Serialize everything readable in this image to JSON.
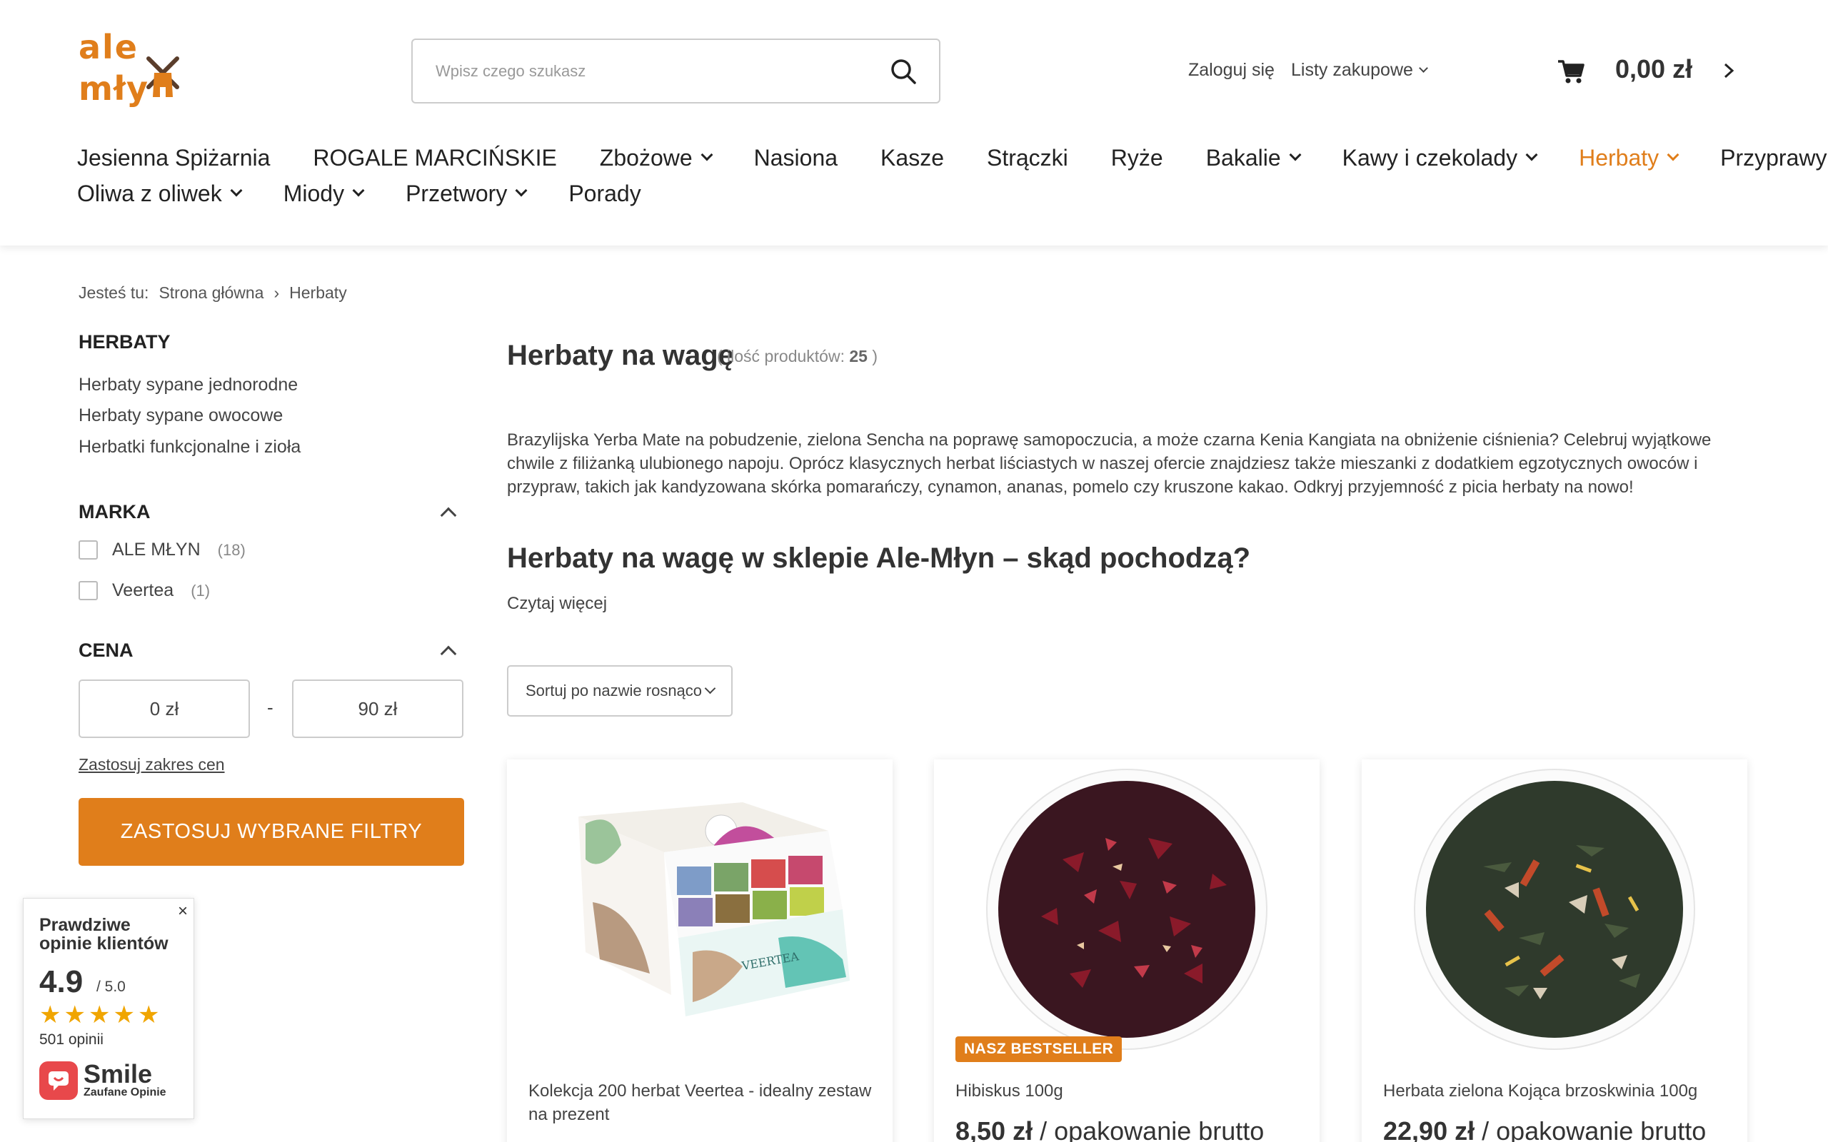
{
  "header": {
    "logo_line1": "ale",
    "logo_line2": "młyn",
    "search_placeholder": "Wpisz czego szukasz",
    "login": "Zaloguj się",
    "shopping_lists": "Listy zakupowe",
    "cart_amount": "0,00 zł"
  },
  "nav": {
    "row1": [
      {
        "label": "Jesienna Spiżarnia",
        "dropdown": false,
        "active": false
      },
      {
        "label": "ROGALE MARCIŃSKIE",
        "dropdown": false,
        "active": false
      },
      {
        "label": "Zbożowe",
        "dropdown": true,
        "active": false
      },
      {
        "label": "Nasiona",
        "dropdown": false,
        "active": false
      },
      {
        "label": "Kasze",
        "dropdown": false,
        "active": false
      },
      {
        "label": "Strączki",
        "dropdown": false,
        "active": false
      },
      {
        "label": "Ryże",
        "dropdown": false,
        "active": false
      },
      {
        "label": "Bakalie",
        "dropdown": true,
        "active": false
      },
      {
        "label": "Kawy i czekolady",
        "dropdown": true,
        "active": false
      },
      {
        "label": "Herbaty",
        "dropdown": true,
        "active": true
      },
      {
        "label": "Przyprawy",
        "dropdown": true,
        "active": false
      }
    ],
    "row2": [
      {
        "label": "Oliwa z oliwek",
        "dropdown": true
      },
      {
        "label": "Miody",
        "dropdown": true
      },
      {
        "label": "Przetwory",
        "dropdown": true
      },
      {
        "label": "Porady",
        "dropdown": false
      }
    ]
  },
  "breadcrumb": {
    "prefix": "Jesteś tu:",
    "home": "Strona główna",
    "current": "Herbaty"
  },
  "sidebar": {
    "category_title": "HERBATY",
    "categories": [
      "Herbaty sypane jednorodne",
      "Herbaty sypane owocowe",
      "Herbatki funkcjonalne i zioła"
    ],
    "brand_title": "MARKA",
    "brands": [
      {
        "label": "ALE MŁYN",
        "count": "(18)"
      },
      {
        "label": "Veertea",
        "count": "(1)"
      }
    ],
    "price_title": "CENA",
    "price_min": "0 zł",
    "price_max": "90 zł",
    "price_dash": "-",
    "apply_range": "Zastosuj zakres cen",
    "apply_filters": "ZASTOSUJ WYBRANE FILTRY"
  },
  "reviews": {
    "close": "×",
    "title_line1": "Prawdziwe",
    "title_line2": "opinie klientów",
    "score": "4.9",
    "max": "/ 5.0",
    "stars": 5,
    "count": "501 opinii",
    "brand": "Smile",
    "brand_sub": "Zaufane Opinie"
  },
  "main": {
    "title": "Herbaty na wagę",
    "count_label": "( ilość produktów:",
    "count_value": "25",
    "count_close": ")",
    "description": "Brazylijska Yerba Mate na pobudzenie, zielona Sencha na poprawę samopoczucia, a może czarna Kenia Kangiata na obniżenie ciśnienia? Celebruj wyjątkowe chwile z filiżanką ulubionego napoju. Oprócz klasycznych herbat liściastych w naszej ofercie znajdziesz także mieszanki z dodatkiem egzotycznych owoców i przypraw, takich jak kandyzowana skórka pomarańczy, cynamon, ananas, pomelo czy kruszone kakao. Odkryj przyjemność z picia herbaty na nowo!",
    "section_heading": "Herbaty na wagę w sklepie Ale-Młyn – skąd pochodzą?",
    "read_more": "Czytaj więcej",
    "sort_label": "Sortuj po nazwie rosnąco"
  },
  "products": [
    {
      "name": "Kolekcja 200 herbat Veertea - idealny zestaw na prezent",
      "price": "",
      "unit": "",
      "badge": ""
    },
    {
      "name": "Hibiskus 100g",
      "price": "8,50 zł",
      "unit": "/ opakowanie brutto",
      "badge": "NASZ BESTSELLER"
    },
    {
      "name": "Herbata zielona Kojąca brzoskwinia 100g",
      "price": "22,90 zł",
      "unit": "/ opakowanie brutto",
      "badge": ""
    }
  ],
  "colors": {
    "accent": "#e07e1b",
    "logo_dark": "#5a3d2b",
    "star": "#f0a500",
    "review_brand": "#e8484b"
  }
}
